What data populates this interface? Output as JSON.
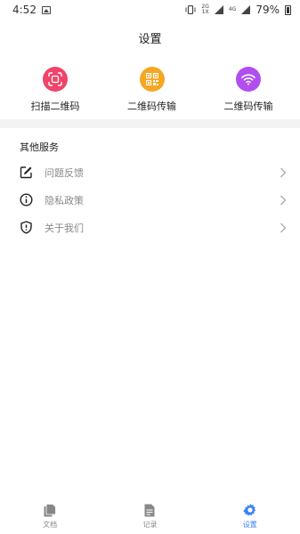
{
  "status_bar": {
    "time": "4:52",
    "network_top": "2G",
    "network_bottom": "1X",
    "network_4g": "4G",
    "battery": "79%"
  },
  "header": {
    "title": "设置"
  },
  "quick_actions": [
    {
      "label": "扫描二维码",
      "color": "#f0446a",
      "icon": "scan-icon"
    },
    {
      "label": "二维码传输",
      "color": "#f5a623",
      "icon": "qr-code-icon"
    },
    {
      "label": "二维码传输",
      "color": "#b14ef0",
      "icon": "wifi-icon"
    }
  ],
  "other_services": {
    "heading": "其他服务",
    "items": [
      {
        "label": "问题反馈",
        "icon": "edit-icon"
      },
      {
        "label": "隐私政策",
        "icon": "info-icon"
      },
      {
        "label": "关于我们",
        "icon": "shield-icon"
      }
    ]
  },
  "bottom_nav": {
    "items": [
      {
        "label": "文档",
        "icon": "document-icon",
        "active": false
      },
      {
        "label": "记录",
        "icon": "record-icon",
        "active": false
      },
      {
        "label": "设置",
        "icon": "gear-icon",
        "active": true
      }
    ],
    "active_color": "#3b82f6"
  }
}
